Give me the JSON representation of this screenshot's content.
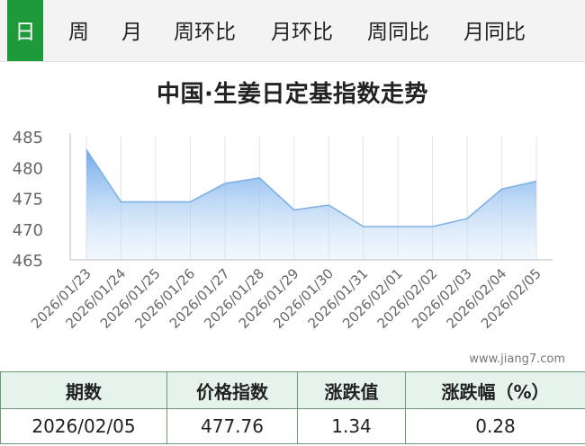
{
  "tabs": [
    {
      "label": "日",
      "active": true
    },
    {
      "label": "周",
      "active": false
    },
    {
      "label": "月",
      "active": false
    },
    {
      "label": "周环比",
      "active": false
    },
    {
      "label": "月环比",
      "active": false
    },
    {
      "label": "周同比",
      "active": false
    },
    {
      "label": "月同比",
      "active": false
    }
  ],
  "watermark": "www.jiang7.com",
  "colors": {
    "accent": "#1f9a3b",
    "line": "#7fb0e6",
    "fill_top": "#6aa6e8",
    "table_header": "#e5f3ec"
  },
  "chart_data": {
    "type": "area",
    "title": "中国·生姜日定基指数走势",
    "x": [
      "2026/01/23",
      "2026/01/24",
      "2026/01/25",
      "2026/01/26",
      "2026/01/27",
      "2026/01/28",
      "2026/01/29",
      "2026/01/30",
      "2026/01/31",
      "2026/02/01",
      "2026/02/02",
      "2026/02/03",
      "2026/02/04",
      "2026/02/05"
    ],
    "values": [
      482.9,
      474.4,
      474.4,
      474.4,
      477.4,
      478.3,
      473.1,
      473.9,
      470.4,
      470.4,
      470.4,
      471.7,
      476.5,
      477.76
    ],
    "ylim": [
      465,
      485
    ],
    "yticks": [
      465,
      470,
      475,
      480,
      485
    ],
    "grid": "vertical"
  },
  "table": {
    "headers": [
      "期数",
      "价格指数",
      "涨跌值",
      "涨跌幅（%）"
    ],
    "row": [
      "2026/02/05",
      "477.76",
      "1.34",
      "0.28"
    ]
  }
}
